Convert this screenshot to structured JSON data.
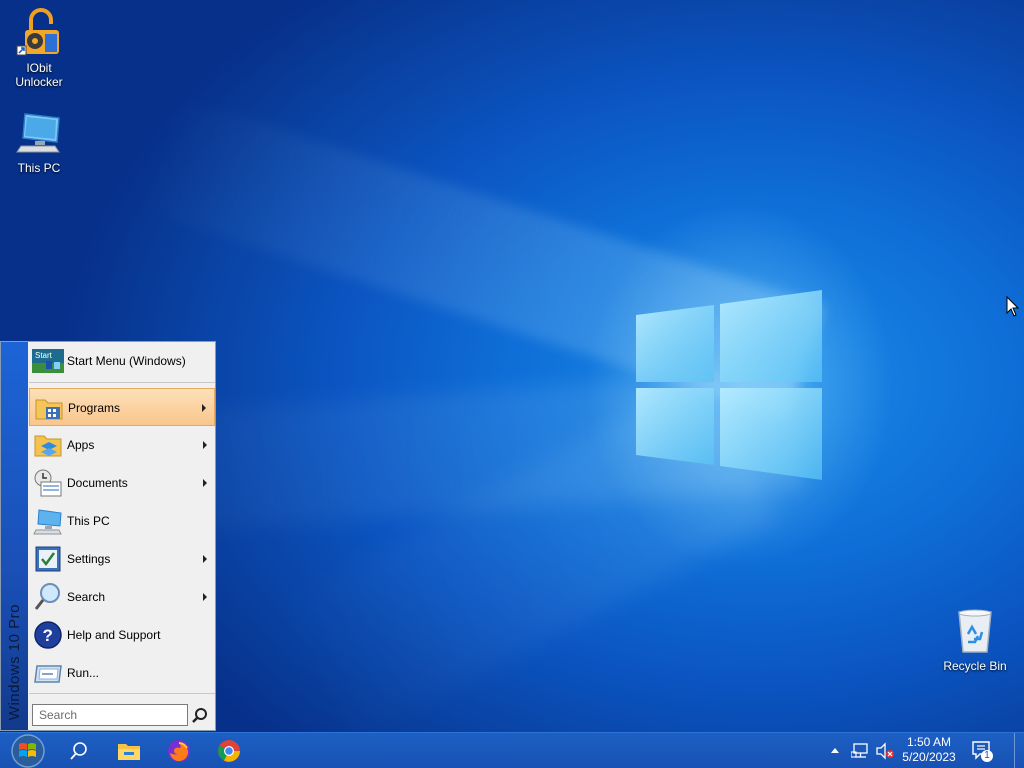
{
  "desktop": {
    "icons": [
      {
        "label": "IObit Unlocker",
        "icon": "iobit-unlocker-icon"
      },
      {
        "label": "This PC",
        "icon": "this-pc-icon"
      },
      {
        "label": "Recycle Bin",
        "icon": "recycle-bin-icon"
      }
    ]
  },
  "start_menu": {
    "side_text": "Windows 10 Pro",
    "header": {
      "icon": "start-menu-icon",
      "icon_text": "Start",
      "label": "Start Menu (Windows)"
    },
    "items": [
      {
        "label": "Programs",
        "icon": "programs-icon",
        "has_submenu": true,
        "active": true
      },
      {
        "label": "Apps",
        "icon": "apps-icon",
        "has_submenu": true
      },
      {
        "label": "Documents",
        "icon": "documents-icon",
        "has_submenu": true
      },
      {
        "label": "This PC",
        "icon": "this-pc-icon",
        "has_submenu": false
      },
      {
        "label": "Settings",
        "icon": "settings-icon",
        "has_submenu": true
      },
      {
        "label": "Search",
        "icon": "search-icon",
        "has_submenu": true
      },
      {
        "label": "Help and Support",
        "icon": "help-icon",
        "has_submenu": false
      },
      {
        "label": "Run...",
        "icon": "run-icon",
        "has_submenu": false
      }
    ],
    "search_placeholder": "Search"
  },
  "taskbar": {
    "pinned": [
      "start-orb-icon",
      "search-icon",
      "file-explorer-icon",
      "firefox-icon",
      "chrome-icon"
    ],
    "tray_icons": [
      "chevron-up-icon",
      "network-icon",
      "volume-muted-icon"
    ],
    "time": "1:50 AM",
    "date": "5/20/2023",
    "notification_count": "1"
  },
  "colors": {
    "accent": "#1852b3",
    "menu_highlight": "#f9c68d",
    "desktop": "#0f6fd8"
  }
}
